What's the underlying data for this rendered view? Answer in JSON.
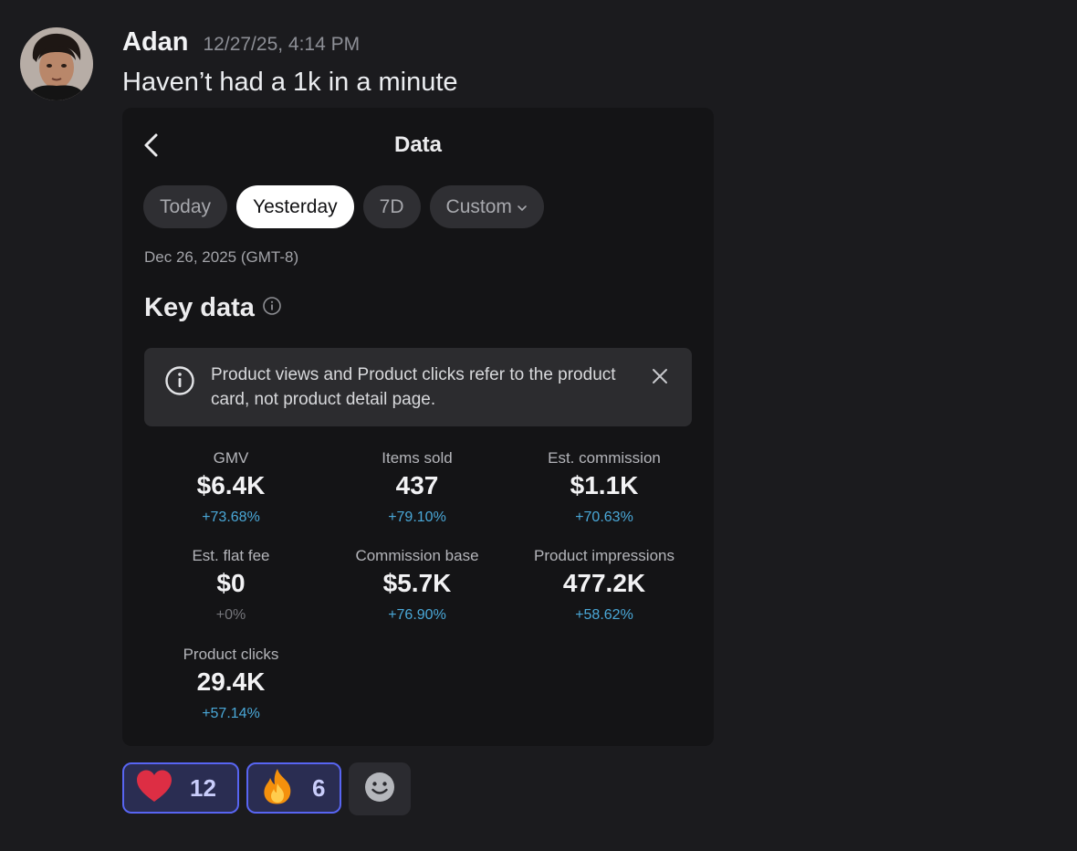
{
  "message": {
    "author": "Adan",
    "timestamp": "12/27/25, 4:14 PM",
    "text": "Haven’t had a 1k in a minute"
  },
  "card": {
    "title": "Data",
    "tabs": [
      {
        "label": "Today",
        "active": false
      },
      {
        "label": "Yesterday",
        "active": true
      },
      {
        "label": "7D",
        "active": false
      },
      {
        "label": "Custom",
        "active": false
      }
    ],
    "date": "Dec 26, 2025 (GMT-8)",
    "section_title": "Key data",
    "notice": "Product views and Product clicks refer to the product card, not product detail page.",
    "metrics": [
      {
        "label": "GMV",
        "value": "$6.4K",
        "change": "+73.68%"
      },
      {
        "label": "Items sold",
        "value": "437",
        "change": "+79.10%"
      },
      {
        "label": "Est. commission",
        "value": "$1.1K",
        "change": "+70.63%"
      },
      {
        "label": "Est. flat fee",
        "value": "$0",
        "change": "+0%"
      },
      {
        "label": "Commission base",
        "value": "$5.7K",
        "change": "+76.90%"
      },
      {
        "label": "Product impressions",
        "value": "477.2K",
        "change": "+58.62%"
      },
      {
        "label": "Product clicks",
        "value": "29.4K",
        "change": "+57.14%"
      }
    ]
  },
  "reactions": [
    {
      "emoji": "heart-emoji",
      "count": "12"
    },
    {
      "emoji": "fire-emoji",
      "count": "6"
    }
  ],
  "colors": {
    "accent": "#5865f2",
    "positive_change": "#4aa8d8",
    "background": "#1b1b1e"
  }
}
